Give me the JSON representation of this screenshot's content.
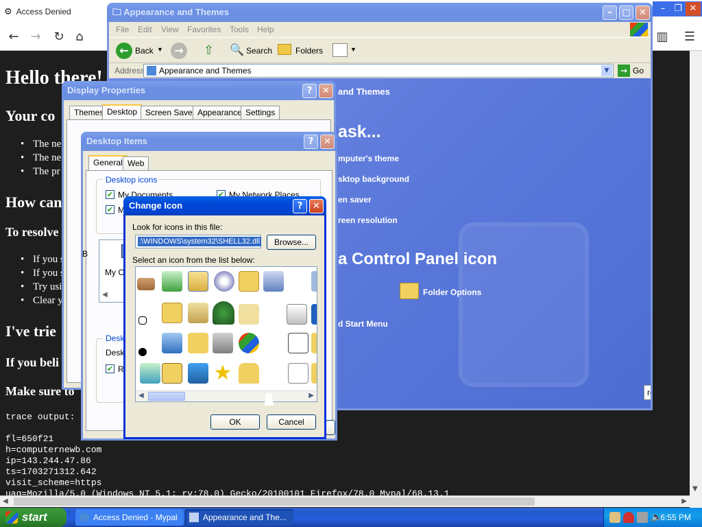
{
  "browser": {
    "tab_title": "Access Denied",
    "page": {
      "h1": "Hello there!",
      "h2_your": "Your co",
      "bullets1": [
        "The ne",
        "The ne",
        "The pr"
      ],
      "h2_how": "How can",
      "h3_resolve": "To resolve",
      "bullets2": [
        "If you s",
        "If you s",
        "Try usi",
        "Clear y"
      ],
      "h2_tried": "I've trie",
      "h3_believe": "If you beli",
      "h3_make": "Make sure to",
      "trace_output": "trace output:\n\nfl=650f21\nh=computernewb.com\nip=143.244.47.86\nts=1703271312.642\nvisit_scheme=https\nuag=Mozilla/5.0 (Windows NT 5.1; rv:78.0) Gecko/20100101 Firefox/78.0 Mypal/68.13.1"
    }
  },
  "explorer": {
    "title": "Appearance and Themes",
    "menu": [
      "File",
      "Edit",
      "View",
      "Favorites",
      "Tools",
      "Help"
    ],
    "toolbar": {
      "back": "Back",
      "search": "Search",
      "folders": "Folders"
    },
    "address_label": "Address",
    "address_value": "Appearance and Themes",
    "go": "Go",
    "content": {
      "header_frag": "and Themes",
      "pick_task": "ask...",
      "tasks": [
        "mputer's theme",
        "sktop background",
        "en saver",
        "reen resolution"
      ],
      "pick_icon": "a Control Panel icon",
      "folder_options": "Folder Options",
      "start_menu": "d Start Menu",
      "btn_frag": "rd"
    }
  },
  "display_props": {
    "title": "Display Properties",
    "tabs": [
      "Themes",
      "Desktop",
      "Screen Saver",
      "Appearance",
      "Settings"
    ]
  },
  "desktop_items": {
    "title": "Desktop Items",
    "tabs": [
      "General",
      "Web"
    ],
    "group_icons": "Desktop icons",
    "cb_my_documents": "My Documents",
    "cb_my_network": "My Network Places",
    "cb_my2": "My",
    "my_computer_frag": "My Co",
    "group_cleanup": "Deskto",
    "label_desktop": "Deskto",
    "cb_ru": "Ru",
    "left_b": "B"
  },
  "change_icon": {
    "title": "Change Icon",
    "look_label": "Look for icons in this file:",
    "file_path": ":\\WINDOWS\\system32\\SHELL32.dll",
    "browse": "Browse...",
    "select_label": "Select an icon from the list below:",
    "ok": "OK",
    "cancel": "Cancel"
  },
  "taskbar": {
    "start": "start",
    "items": [
      "Access Denied - Mypal",
      "Appearance and The..."
    ],
    "clock": "6:55 PM"
  }
}
